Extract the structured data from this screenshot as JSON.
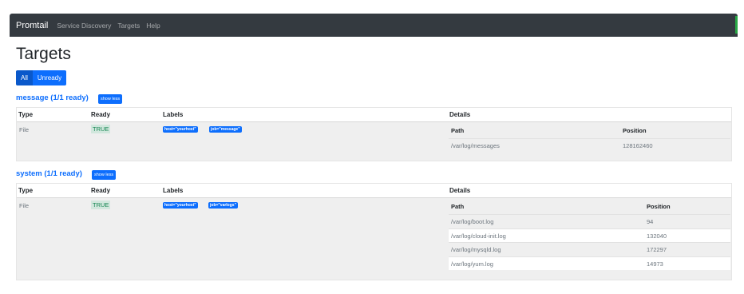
{
  "nav": {
    "brand": "Promtail",
    "links": [
      "Service Discovery",
      "Targets",
      "Help"
    ]
  },
  "page": {
    "title": "Targets"
  },
  "filter": {
    "all_label": "All",
    "unready_label": "Unready"
  },
  "columns": {
    "type": "Type",
    "ready": "Ready",
    "labels": "Labels",
    "details": "Details"
  },
  "detail_columns": {
    "path": "Path",
    "position": "Position"
  },
  "sections": [
    {
      "title": "message (1/1 ready)",
      "toggle_label": "show less",
      "type": "File",
      "ready": "TRUE",
      "labels": [
        "host=\"yourhost\"",
        "job=\"message\""
      ],
      "files": [
        {
          "path": "/var/log/messages",
          "position": "128162460"
        }
      ]
    },
    {
      "title": "system (1/1 ready)",
      "toggle_label": "show less",
      "type": "File",
      "ready": "TRUE",
      "labels": [
        "host=\"yourhost\"",
        "job=\"varlogs\""
      ],
      "files": [
        {
          "path": "/var/log/boot.log",
          "position": "94"
        },
        {
          "path": "/var/log/cloud-init.log",
          "position": "132040"
        },
        {
          "path": "/var/log/mysqld.log",
          "position": "172297"
        },
        {
          "path": "/var/log/yum.log",
          "position": "14973"
        }
      ]
    }
  ]
}
